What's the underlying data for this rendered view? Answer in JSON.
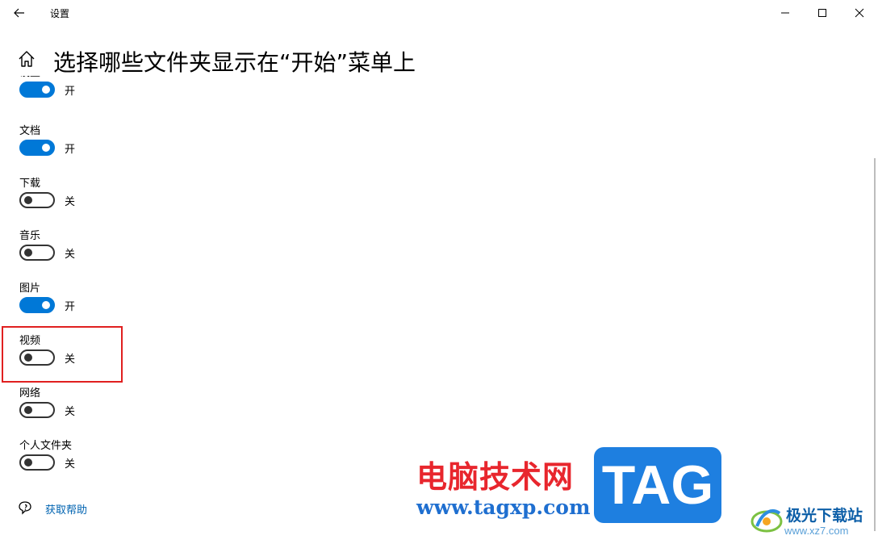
{
  "window": {
    "title": "设置",
    "back_icon": "arrow-left-icon",
    "minimize_icon": "minimize-icon",
    "maximize_icon": "maximize-icon",
    "close_icon": "close-icon"
  },
  "header": {
    "home_icon": "home-icon",
    "title": "选择哪些文件夹显示在“开始”菜单上"
  },
  "folders": [
    {
      "label": "设置",
      "state": "开",
      "on": true
    },
    {
      "label": "文档",
      "state": "开",
      "on": true
    },
    {
      "label": "下载",
      "state": "关",
      "on": false
    },
    {
      "label": "音乐",
      "state": "关",
      "on": false
    },
    {
      "label": "图片",
      "state": "开",
      "on": true
    },
    {
      "label": "视频",
      "state": "关",
      "on": false
    },
    {
      "label": "网络",
      "state": "关",
      "on": false
    },
    {
      "label": "个人文件夹",
      "state": "关",
      "on": false
    }
  ],
  "help": {
    "icon": "help-chat-icon",
    "label": "获取帮助"
  },
  "watermark": {
    "site_name": "电脑技术网",
    "url": "www.tagxp.com",
    "badge": "TAG",
    "site2_name": "极光下载站",
    "site2_url": "www.xz7.com"
  },
  "colors": {
    "accent": "#0078d7",
    "highlight": "#e02020",
    "link": "#0063b1"
  }
}
